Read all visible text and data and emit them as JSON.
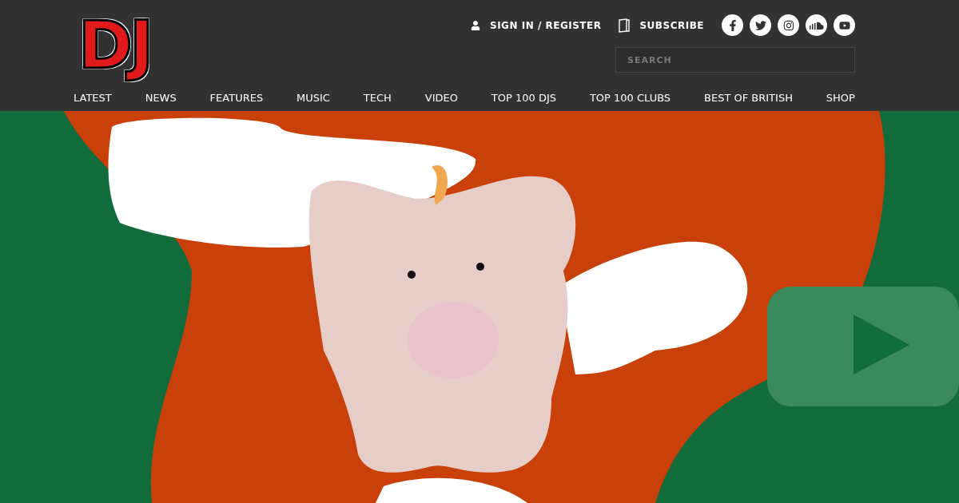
{
  "logo": {
    "text": "DJ"
  },
  "account": [
    {
      "kind": "user",
      "label": "SIGN IN / REGISTER"
    },
    {
      "kind": "subscribe",
      "label": "SUBSCRIBE"
    }
  ],
  "social": [
    {
      "kind": "facebook"
    },
    {
      "kind": "twitter"
    },
    {
      "kind": "instagram"
    },
    {
      "kind": "soundcloud"
    },
    {
      "kind": "youtube"
    }
  ],
  "search": {
    "placeholder": "SEARCH"
  },
  "nav": [
    "LATEST",
    "NEWS",
    "FEATURES",
    "MUSIC",
    "TECH",
    "VIDEO",
    "TOP 100 DJS",
    "TOP 100 CLUBS",
    "BEST OF BRITISH",
    "SHOP"
  ]
}
